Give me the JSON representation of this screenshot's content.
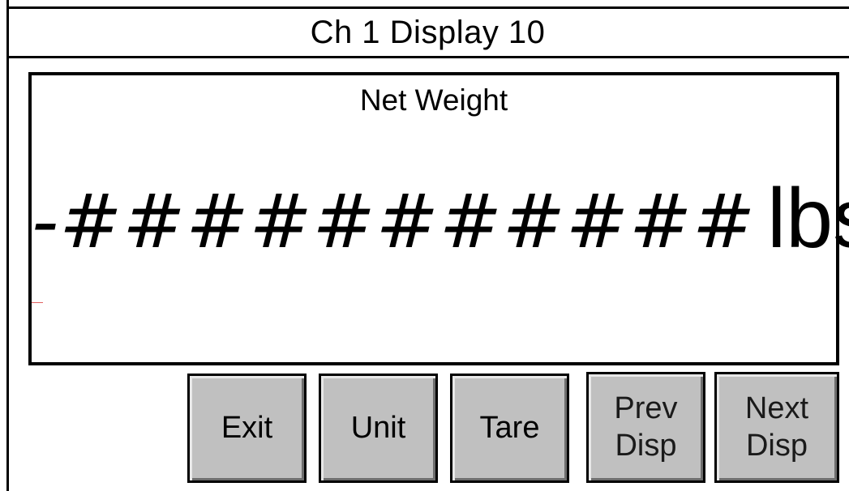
{
  "title": "Ch 1 Display 10",
  "display": {
    "label": "Net Weight",
    "value": "-###########",
    "unit": "lbs"
  },
  "buttons": {
    "exit": "Exit",
    "unit": "Unit",
    "tare": "Tare",
    "prev": "Prev\nDisp",
    "next": "Next\nDisp"
  },
  "colors": {
    "background": "#ffffff",
    "button_face": "#c0c0c0",
    "border": "#000000"
  }
}
